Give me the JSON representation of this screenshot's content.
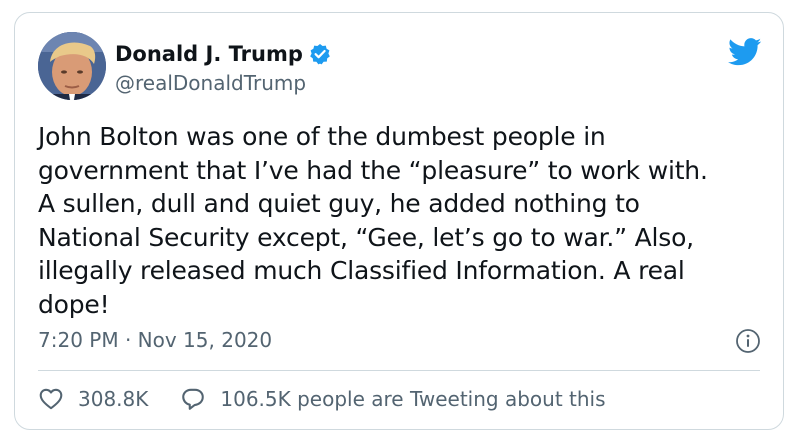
{
  "author": {
    "display_name": "Donald J. Trump",
    "handle": "@realDonaldTrump",
    "verified": true,
    "avatar_icon": "avatar-photo"
  },
  "tweet": {
    "text": "John Bolton was one of the dumbest people in\ngovernment that I’ve had the “pleasure” to work with.\nA sullen, dull and quiet guy, he added nothing to\nNational Security except, “Gee, let’s go to war.” Also,\nillegally released much Classified Information. A real\ndope!",
    "timestamp": "7:20 PM · Nov 15, 2020"
  },
  "stats": {
    "likes": "308.8K",
    "conversation": "106.5K people are Tweeting about this"
  },
  "icons": {
    "brand": "twitter-bird-icon",
    "verified": "verified-badge-icon",
    "info": "info-icon",
    "like": "heart-icon",
    "reply": "speech-bubble-icon"
  },
  "colors": {
    "brand_blue": "#1d9bf0",
    "text_primary": "#0f1419",
    "text_secondary": "#536471",
    "border": "#cfd9de"
  }
}
